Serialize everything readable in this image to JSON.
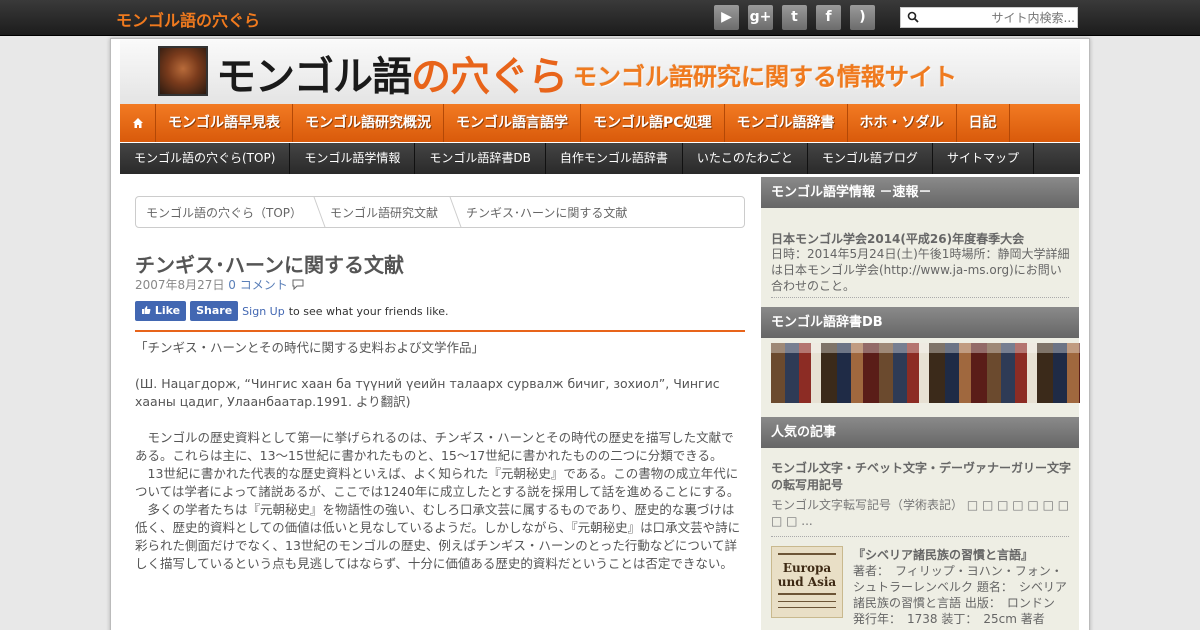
{
  "topbar": {
    "site_name": "モンゴル語の穴ぐら",
    "social": [
      {
        "icon": "youtube-icon",
        "glyph": "▶"
      },
      {
        "icon": "google-plus-icon",
        "glyph": "g+"
      },
      {
        "icon": "twitter-icon",
        "glyph": "t"
      },
      {
        "icon": "facebook-icon",
        "glyph": "f"
      },
      {
        "icon": "rss-icon",
        "glyph": ")"
      }
    ],
    "search_placeholder": "サイト内検索..."
  },
  "header": {
    "logo_main": "モンゴル語",
    "logo_accent": "の穴ぐら",
    "tagline": "モンゴル語研究に関する情報サイト"
  },
  "main_nav": {
    "home_icon": "home-icon",
    "items": [
      "モンゴル語早見表",
      "モンゴル語研究概況",
      "モンゴル語言語学",
      "モンゴル語PC処理",
      "モンゴル語辞書",
      "ホホ・ソダル",
      "日記"
    ]
  },
  "sub_nav": {
    "items": [
      "モンゴル語の穴ぐら(TOP)",
      "モンゴル語学情報",
      "モンゴル語辞書DB",
      "自作モンゴル語辞書",
      "いたこのたわごと",
      "モンゴル語ブログ",
      "サイトマップ"
    ]
  },
  "breadcrumb": [
    "モンゴル語の穴ぐら（TOP）",
    "モンゴル語研究文献",
    "チンギス･ハーンに関する文献"
  ],
  "article": {
    "title": "チンギス･ハーンに関する文献",
    "date": "2007年8月27日",
    "comments": "0 コメント",
    "fb_like": "Like",
    "fb_share": "Share",
    "fb_signup": "Sign Up",
    "fb_text": "to see what your friends like.",
    "paragraphs": [
      "「チンギス・ハーンとその時代に関する史料および文学作品」",
      "(Ш. Нацагдорж, “Чингис хаан ба түүний үеийн талаарх сурвалж бичиг, зохиол”, Чингис хааны цадиг, Улаанбаатар.1991. より翻訳)",
      "　モンゴルの歴史資料として第一に挙げられるのは、チンギス・ハーンとその時代の歴史を描写した文献である。これらは主に、13～15世紀に書かれたものと、15～17世紀に書かれたものの二つに分類できる。",
      "　13世紀に書かれた代表的な歴史資料といえば、よく知られた『元朝秘史』である。この書物の成立年代については学者によって諸説あるが、ここでは1240年に成立したとする説を採用して話を進めることにする。",
      "　多くの学者たちは『元朝秘史』を物語性の強い、むしろ口承文芸に属するものであり、歴史的な裏づけは低く、歴史的資料としての価値は低いと見なしているようだ。しかしながら、『元朝秘史』は口承文芸や詩に彩られた側面だけでなく、13世紀のモンゴルの歴史、例えばチンギス・ハーンのとった行動などについて詳しく描写しているという点も見逃してはならず、十分に価値ある歴史的資料だということは否定できない。"
    ]
  },
  "sidebar": {
    "news_heading": "モンゴル語学情報 －速報－",
    "news_title": "日本モンゴル学会2014(平成26)年度春季大会",
    "news_body": "日時：2014年5月24日(土)午後1時場所：静岡大学詳細は日本モンゴル学会(http://www.ja-ms.org)にお問い合わせのこと。",
    "dict_heading": "モンゴル語辞書DB",
    "popular_heading": "人気の記事",
    "popular1_title": "モンゴル文字・チベット文字・デーヴァナーガリー文字の転写用記号",
    "popular1_body": "モンゴル文字転写記号（学術表記） □ □ □ □ □ □ □ □ □ ...",
    "popular2_title": "『シベリア諸民族の習慣と言語』",
    "popular2_body": "著者：　フィリップ・ヨハン・フォン・シュトラーレンベルク 題名：　シベリア諸民族の習慣と言語 出版：　ロンドン 発行年：　1738 装丁：　25cm 著者",
    "thumb_text_1": "Europa und Asia"
  },
  "colors": {
    "accent": "#e8641a",
    "topbar": "#2a2a2a",
    "subnav": "#333333",
    "sidebar_heading": "#777777"
  }
}
